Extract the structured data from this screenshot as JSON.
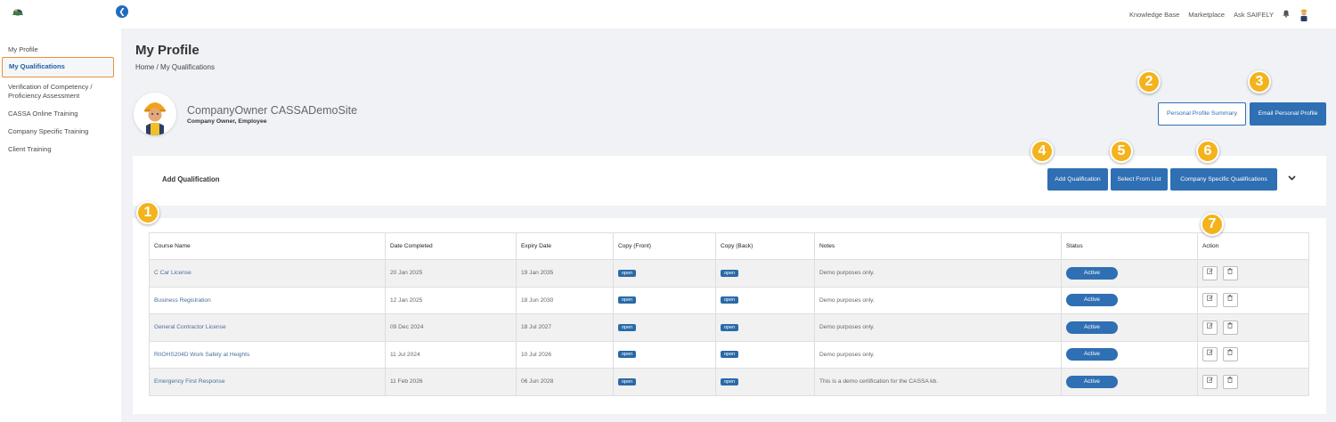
{
  "sidebar": {
    "items": [
      {
        "label": "My Profile"
      },
      {
        "label": "My Qualifications"
      },
      {
        "label": "Verification of Competency / Proficiency Assessment"
      },
      {
        "label": "CASSA Online Training"
      },
      {
        "label": "Company Specific Training"
      },
      {
        "label": "Client Training"
      }
    ]
  },
  "topbar": {
    "links": [
      "Knowledge Base",
      "Marketplace",
      "Ask SAIFELY"
    ]
  },
  "page": {
    "title": "My Profile",
    "breadcrumb_home": "Home",
    "breadcrumb_sep": "/",
    "breadcrumb_current": "My Qualifications"
  },
  "profile": {
    "name": "CompanyOwner CASSADemoSite",
    "role": "Company Owner, Employee"
  },
  "buttons": {
    "personal_summary": "Personal Profile Summary",
    "email_profile": "Email Personal Profile",
    "add_qualification": "Add Qualification",
    "select_from_list": "Select From List",
    "company_specific": "Company Specific Qualifications"
  },
  "add_panel": {
    "title": "Add Qualification"
  },
  "badges": [
    "1",
    "2",
    "3",
    "4",
    "5",
    "6",
    "7"
  ],
  "table": {
    "headers": [
      "Course Name",
      "Date Completed",
      "Expiry Date",
      "Copy (Front)",
      "Copy (Back)",
      "Notes",
      "Status",
      "Action"
    ],
    "rows": [
      {
        "course": "C Car License",
        "completed": "20 Jan 2025",
        "expiry": "19 Jan 2035",
        "front": "open",
        "back": "open",
        "notes": "Demo purposes only.",
        "status": "Active"
      },
      {
        "course": "Business Registration",
        "completed": "12 Jan 2025",
        "expiry": "18 Jun 2030",
        "front": "open",
        "back": "open",
        "notes": "Demo purposes only.",
        "status": "Active"
      },
      {
        "course": "General Contractor License",
        "completed": "09 Dec 2024",
        "expiry": "18 Jul 2027",
        "front": "open",
        "back": "open",
        "notes": "Demo purposes only.",
        "status": "Active"
      },
      {
        "course": "RIIOHS204D Work Safely at Heights",
        "completed": "11 Jul 2024",
        "expiry": "10 Jul 2026",
        "front": "open",
        "back": "open",
        "notes": "Demo purposes only.",
        "status": "Active"
      },
      {
        "course": "Emergency First Response",
        "completed": "11 Feb 2026",
        "expiry": "06 Jun 2028",
        "front": "open",
        "back": "open",
        "notes": "This is a demo certification for the CASSA kb.",
        "status": "Active"
      }
    ]
  },
  "icons": {
    "edit": "edit-icon",
    "delete": "trash-icon",
    "collapse": "chevron-left-icon",
    "expand": "chevron-down-icon",
    "bell": "bell-icon"
  },
  "colors": {
    "primary": "#2f6fb3",
    "badge": "#f4b31c",
    "highlight_border": "#e8903a"
  }
}
